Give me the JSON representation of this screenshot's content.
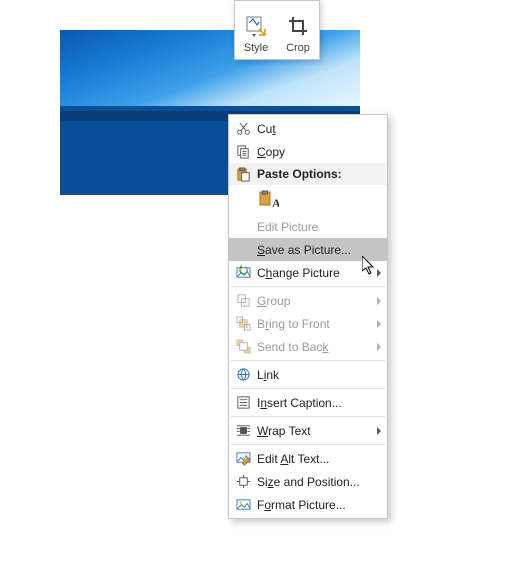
{
  "mini_toolbar": {
    "style_label": "Style",
    "crop_label": "Crop"
  },
  "menu": {
    "cut": "Cut",
    "copy": "Copy",
    "paste_options": "Paste Options:",
    "edit_picture": "Edit Picture",
    "save_as_picture": "Save as Picture...",
    "change_picture": "Change Picture",
    "group": "Group",
    "bring_to_front": "Bring to Front",
    "send_to_back": "Send to Back",
    "link": "Link",
    "insert_caption": "Insert Caption...",
    "wrap_text": "Wrap Text",
    "edit_alt_text": "Edit Alt Text...",
    "size_and_position": "Size and Position...",
    "format_picture": "Format Picture..."
  },
  "underline_chars": {
    "cut": "t",
    "copy": "C",
    "save": "S",
    "change": "h",
    "group": "G",
    "front": "R",
    "back": "K",
    "link": "i",
    "caption": "n",
    "wrap": "W",
    "alt": "A",
    "size": "z",
    "format": "o"
  }
}
